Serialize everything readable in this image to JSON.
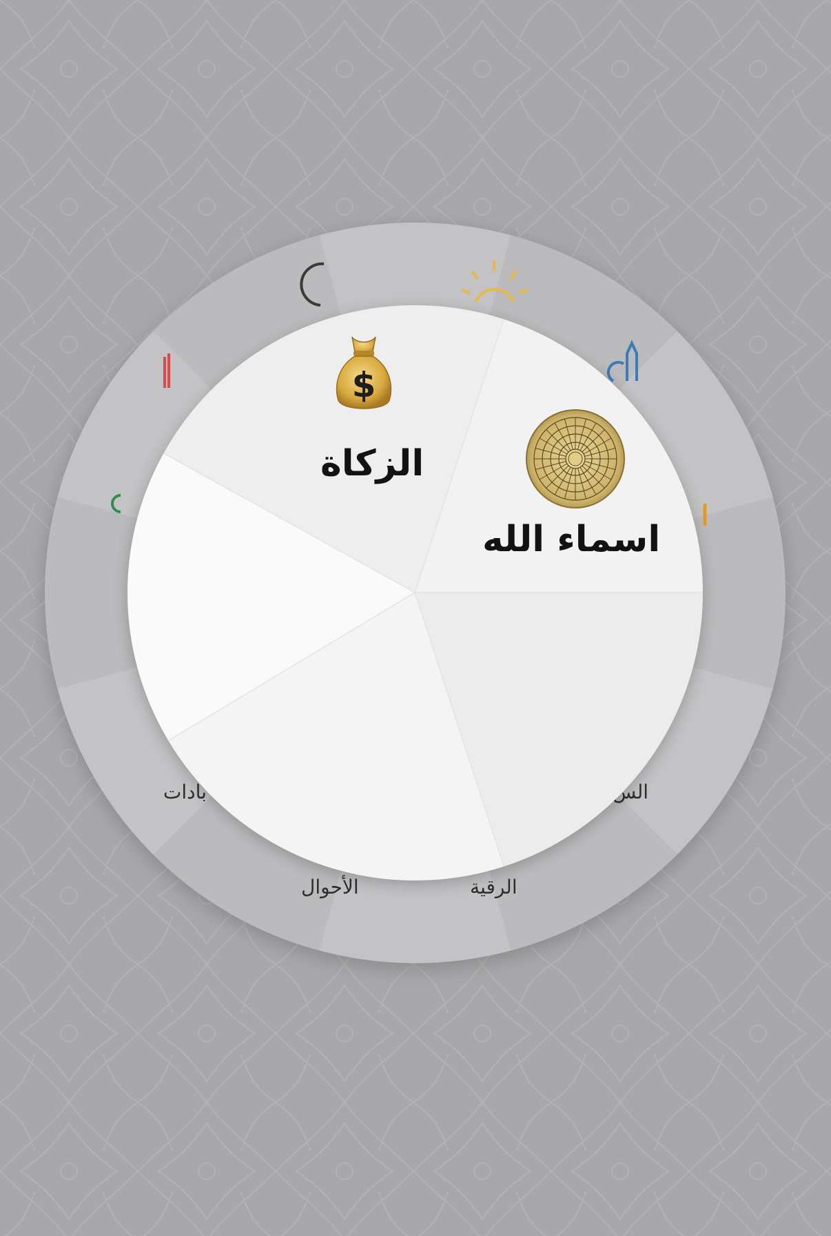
{
  "outer_menu": {
    "visible_labels": [
      {
        "id": "ruqya",
        "label": "الرقية"
      },
      {
        "id": "ahwal",
        "label": "الأحوال"
      },
      {
        "id": "ibadat",
        "label": "بادات"
      },
      {
        "id": "right_partial",
        "label": "الس"
      }
    ],
    "icons": [
      "sun-icon",
      "moon-icon",
      "mosque-icon",
      "minaret-icon",
      "lantern-icon",
      "crescent-icon"
    ],
    "icon_colors": {
      "sun": "#e8b84a",
      "moon": "#3a3a3a",
      "mosque": "#3d7bb8",
      "minaret_left": "#d94a4a",
      "lantern": "#e39a2b",
      "crescent": "#2f8f4f"
    }
  },
  "inner_menu": {
    "items": [
      {
        "id": "zakat",
        "label": "الزكاة",
        "icon": "money-bag-icon"
      },
      {
        "id": "asma_allah",
        "label": "اسماء الله",
        "icon": "allah-names-medallion-icon"
      }
    ]
  },
  "colors": {
    "background": "#a8a7a9",
    "outer_ring": "#bdbcbe",
    "inner_disc": "#f4f4f4"
  }
}
